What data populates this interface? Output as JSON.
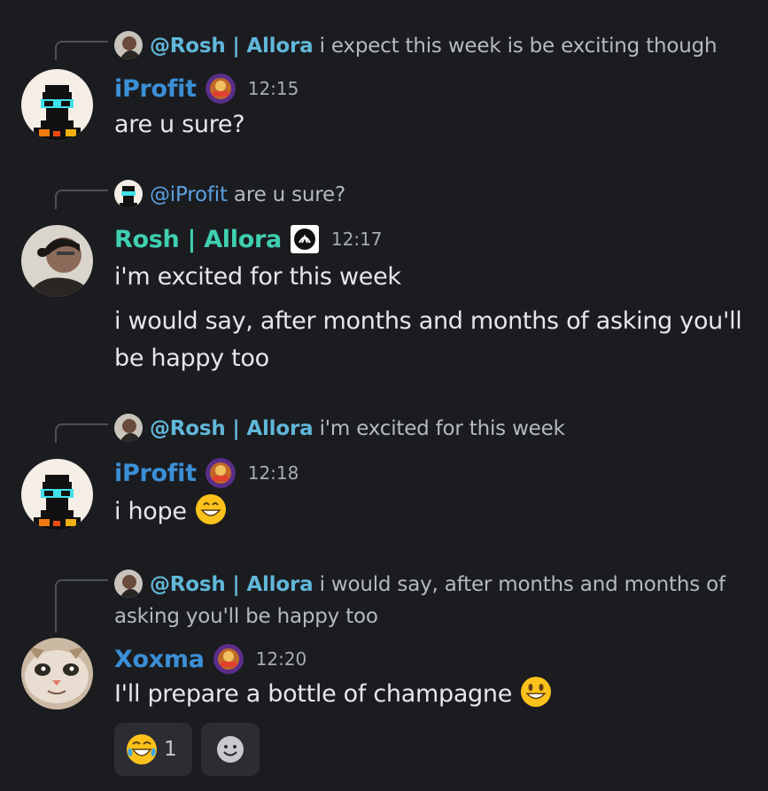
{
  "messages": [
    {
      "reply": {
        "mention": "@Rosh | Allora",
        "text": "i expect this week is be exciting though"
      },
      "author": "iProfit",
      "time": "12:15",
      "lines": [
        "are u sure?"
      ]
    },
    {
      "reply": {
        "mention": "@iProfit",
        "text": "are u sure?"
      },
      "author": "Rosh | Allora",
      "time": "12:17",
      "lines": [
        "i'm excited for this week",
        "i would say, after months and months of asking you'll be happy too"
      ]
    },
    {
      "reply": {
        "mention": "@Rosh | Allora",
        "text": "i'm excited for this week"
      },
      "author": "iProfit",
      "time": "12:18",
      "lines": [
        "i hope"
      ]
    },
    {
      "reply": {
        "mention": "@Rosh | Allora",
        "text": "i would say, after months and months of asking you'll be happy too"
      },
      "author": "Xoxma",
      "time": "12:20",
      "lines": [
        "I'll prepare a bottle of champagne"
      ]
    }
  ],
  "reactions": [
    {
      "emoji": "joy-emoji",
      "count": "1"
    },
    {
      "emoji": "add-reaction-icon",
      "count": ""
    }
  ],
  "colors": {
    "background": "#1b1c20",
    "iprofit": "#3b8fd6",
    "rosh": "#3fcfb0",
    "mention": "#61b7d9"
  }
}
